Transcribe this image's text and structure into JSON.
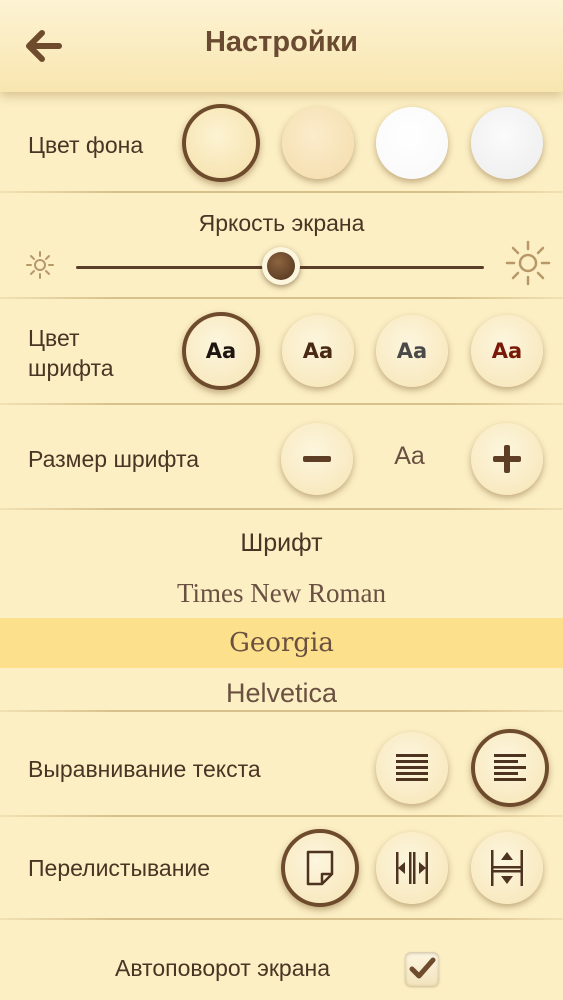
{
  "header": {
    "title": "Настройки",
    "back_icon": "arrow-left-icon"
  },
  "background_color": {
    "label": "Цвет фона",
    "swatches": [
      "cream-textured",
      "light-peach",
      "white",
      "white-textured"
    ],
    "selected_index": 0
  },
  "brightness": {
    "label": "Яркость экрана",
    "min_icon": "sun-small-icon",
    "max_icon": "sun-large-icon",
    "level": 0.5
  },
  "font_color": {
    "label_line1": "Цвет",
    "label_line2": "шрифта",
    "sample": "Aa",
    "colors": [
      "#1e1610",
      "#4a2a14",
      "#4a4a4a",
      "#7a1a08"
    ],
    "selected_index": 0
  },
  "font_size": {
    "label": "Размер шрифта",
    "decrease_icon": "minus-icon",
    "sample": "Aa",
    "increase_icon": "plus-icon"
  },
  "font": {
    "label": "Шрифт",
    "options": [
      "Times New Roman",
      "Georgia",
      "Helvetica"
    ],
    "selected": "Georgia"
  },
  "text_alignment": {
    "label": "Выравнивание текста",
    "options": [
      "justify-icon",
      "align-left-icon"
    ],
    "selected_index": 1
  },
  "page_turning": {
    "label": "Перелистывание",
    "options": [
      "page-curl-icon",
      "horizontal-slide-icon",
      "vertical-scroll-icon"
    ],
    "selected_index": 0
  },
  "autorotate": {
    "label": "Автоповорот экрана",
    "checked": true
  },
  "colors": {
    "background": "#fcefc4",
    "accent_brown": "#6e4b2c",
    "selected_row": "#fde08c"
  }
}
